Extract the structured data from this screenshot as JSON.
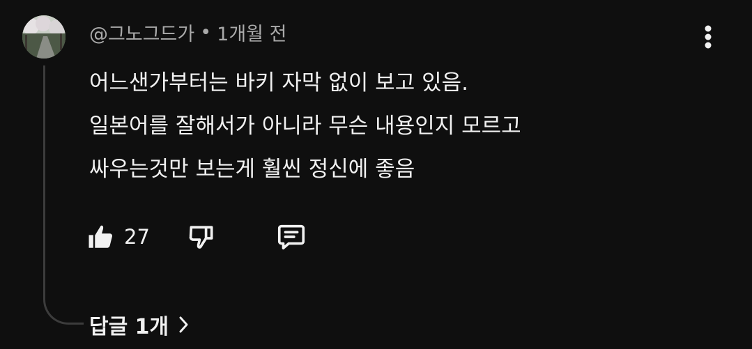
{
  "comment": {
    "author": "@그노그드가",
    "separator": "•",
    "timestamp": "1개월 전",
    "lines": [
      "어느샌가부터는 바키 자막 없이 보고 있음.",
      "일본어를 잘해서가 아니라 무슨 내용인지 모르고",
      "싸우는것만 보는게 훨씬 정신에 좋음"
    ],
    "like_count": "27",
    "replies_label": "답글 1개"
  },
  "icons": {
    "avatar": "avatar-photo",
    "menu": "more-vertical-icon",
    "like": "thumbs-up-filled-icon",
    "dislike": "thumbs-down-outline-icon",
    "reply": "comment-reply-icon",
    "replies_chevron": "chevron-right-icon"
  },
  "colors": {
    "background": "#0f0f0f",
    "primary_text": "#f1f1f1",
    "secondary_text": "#aaaaaa",
    "thread_line": "#3c3c3c"
  }
}
